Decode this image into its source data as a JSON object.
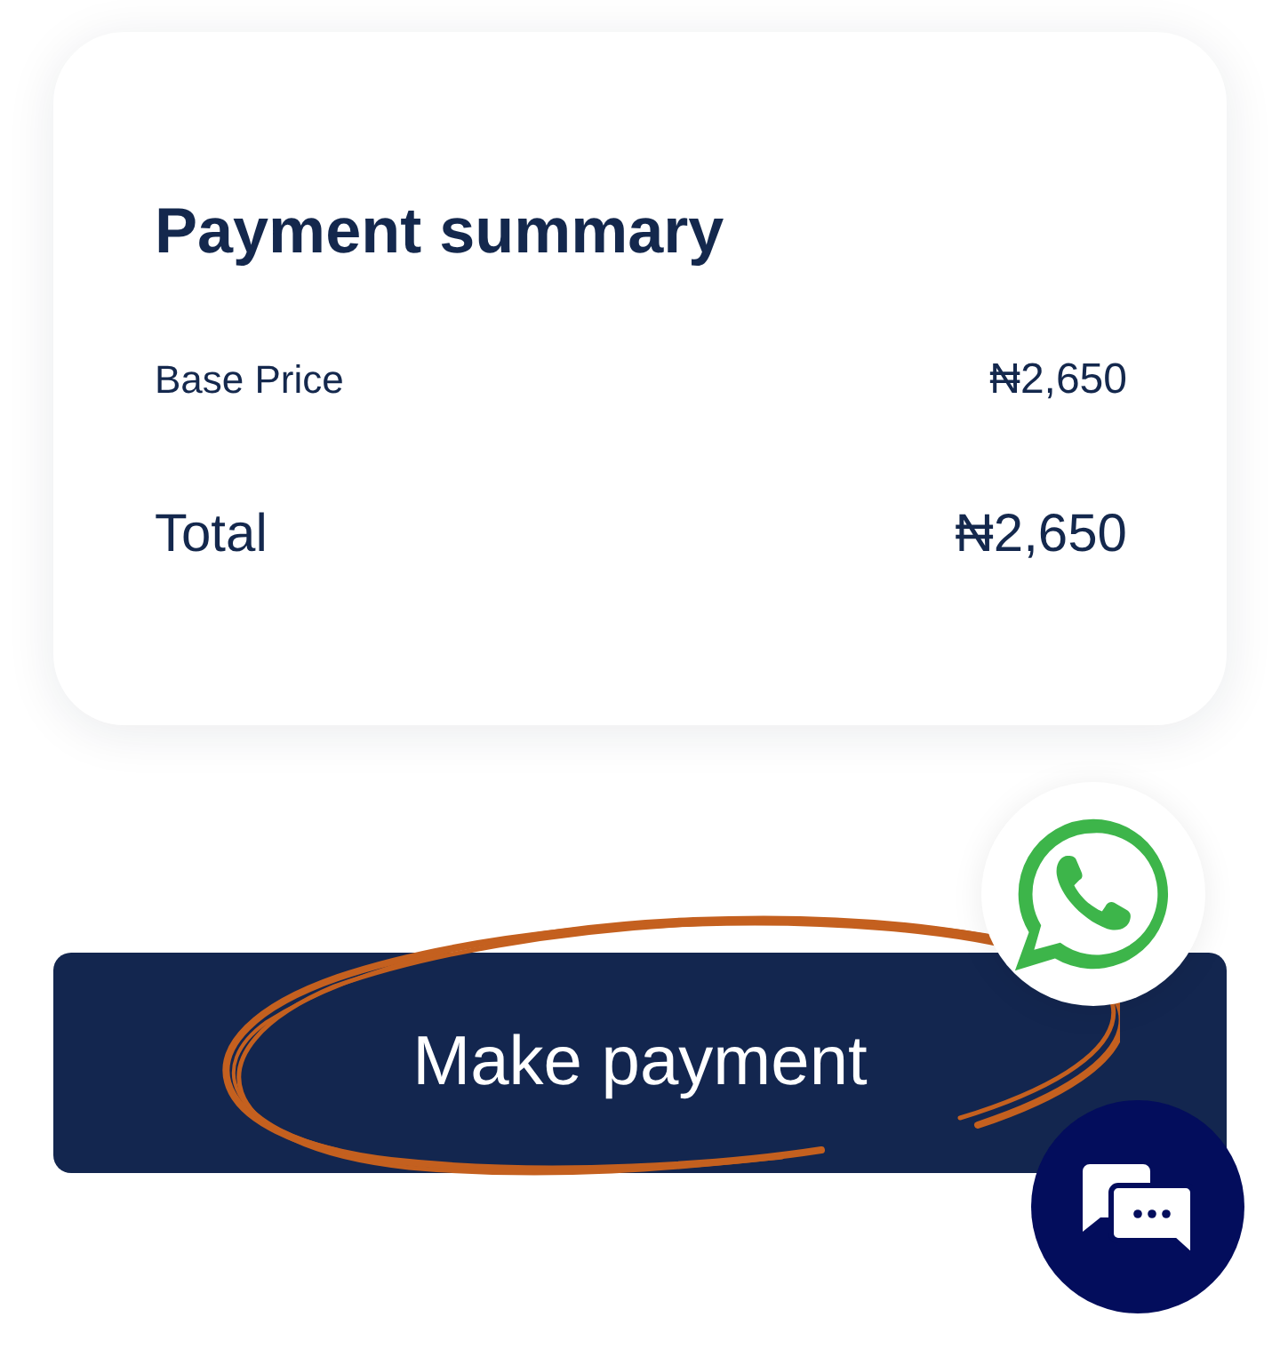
{
  "summary": {
    "title": "Payment summary",
    "rows": [
      {
        "kind": "item",
        "label": "Base Price",
        "amount": "₦2,650"
      },
      {
        "kind": "total",
        "label": "Total",
        "amount": "₦2,650"
      }
    ]
  },
  "primary_button": {
    "label": "Make payment",
    "circled": true
  },
  "floating_buttons": [
    {
      "kind": "whatsapp"
    },
    {
      "kind": "chat"
    }
  ]
}
